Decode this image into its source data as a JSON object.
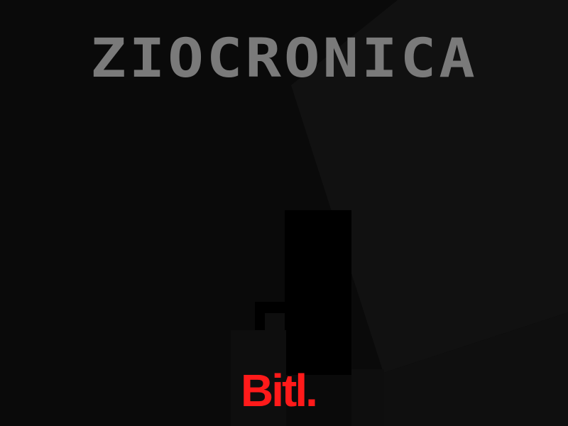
{
  "title": {
    "text": "ZIOCRONICA",
    "color": "#7a7a7a"
  },
  "logo": {
    "text": "Bitl.",
    "color": "#ff1a1a"
  },
  "palette": {
    "background": "#0a0a0a",
    "panel": "#111111",
    "panel_light": "#141414",
    "silhouette": "#000000",
    "silhouette_soft": "#0e0e0e"
  }
}
